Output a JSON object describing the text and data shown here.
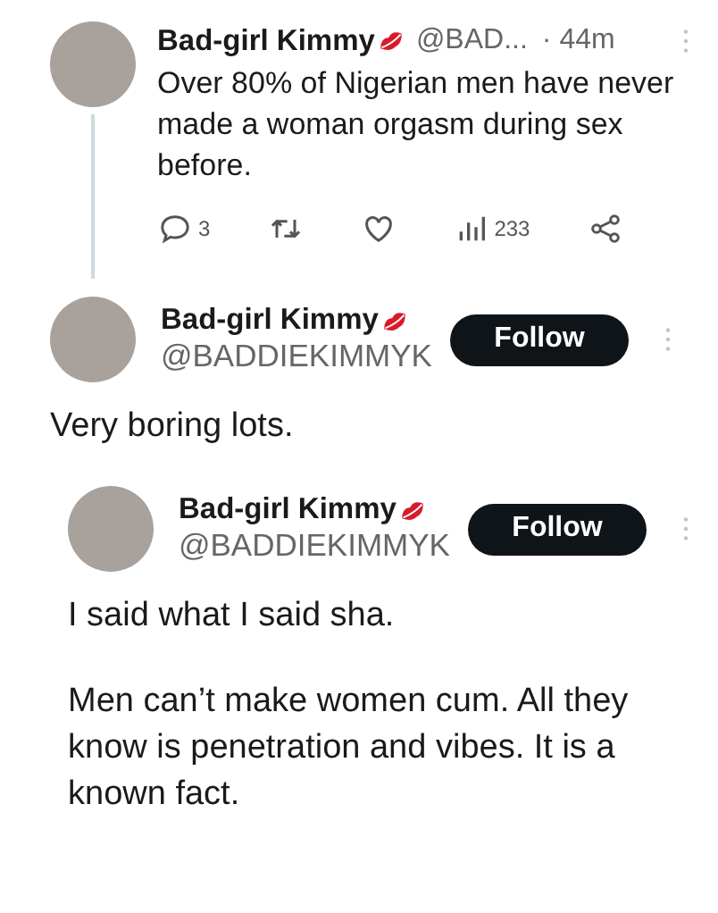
{
  "tweet": {
    "name": "Bad-girl Kimmy",
    "handle": "@BAD...",
    "time": "· 44m",
    "text": "Over 80% of Nigerian men have never made a woman orgasm during sex before.",
    "reply_count": "3",
    "view_count": "233"
  },
  "profile": {
    "name": "Bad-girl Kimmy",
    "handle": "@BADDIEKIMMYK",
    "follow": "Follow"
  },
  "reply_text": "Very boring lots.",
  "quoted_profile": {
    "name": "Bad-girl Kimmy",
    "handle": "@BADDIEKIMMYK",
    "follow": "Follow"
  },
  "quoted_paragraphs": [
    "I said what I said sha.",
    "Men can’t make women cum. All they know is penetration and vibes. It is a known fact."
  ]
}
